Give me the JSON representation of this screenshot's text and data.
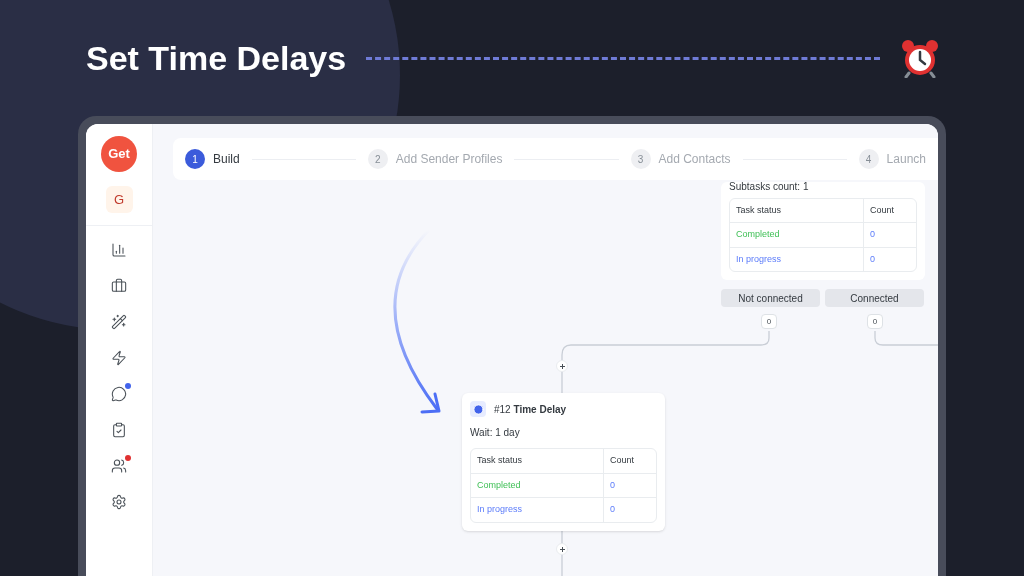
{
  "headline": "Set Time Delays",
  "sidebar": {
    "logo": "Get",
    "avatar": "G",
    "items": [
      {
        "notification": false
      },
      {
        "notification": false
      },
      {
        "notification": false
      },
      {
        "notification": false
      },
      {
        "notification": true,
        "color": "#4263eb"
      },
      {
        "notification": false
      },
      {
        "notification": true,
        "color": "#e03131"
      },
      {
        "notification": false
      }
    ]
  },
  "steps": [
    {
      "number": "1",
      "label": "Build",
      "selected": true
    },
    {
      "number": "2",
      "label": "Add Sender Profiles",
      "selected": false
    },
    {
      "number": "3",
      "label": "Add Contacts",
      "selected": false
    },
    {
      "number": "4",
      "label": "Launch",
      "selected": false
    }
  ],
  "top_node": {
    "subtitle": "Subtasks count: 1",
    "columns": [
      "Task status",
      "Count"
    ],
    "rows": [
      {
        "kind": "completed",
        "status": "Completed",
        "count": "0"
      },
      {
        "kind": "progress",
        "status": "In progress",
        "count": "0"
      }
    ],
    "branches": [
      {
        "label": "Not connected",
        "count": "0"
      },
      {
        "label": "Connected",
        "count": "0"
      }
    ]
  },
  "delay_node": {
    "number": "#12",
    "title": "Time Delay",
    "subtitle": "Wait: 1 day",
    "columns": [
      "Task status",
      "Count"
    ],
    "rows": [
      {
        "kind": "completed",
        "status": "Completed",
        "count": "0"
      },
      {
        "kind": "progress",
        "status": "In progress",
        "count": "0"
      }
    ]
  }
}
